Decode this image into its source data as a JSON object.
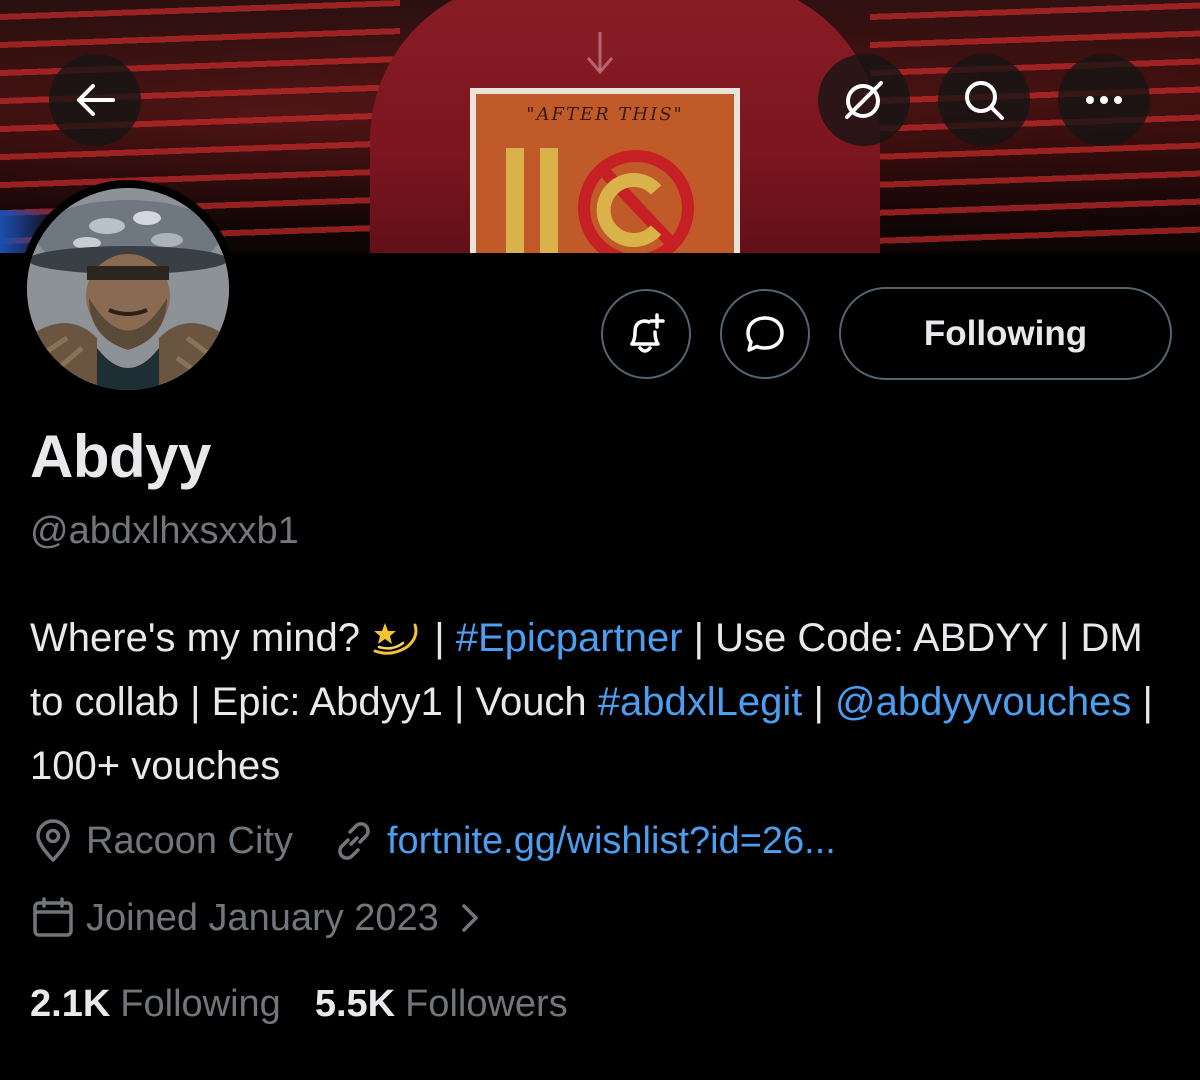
{
  "header": {
    "back_icon": "arrow-left-icon",
    "grok_icon": "grok-icon",
    "search_icon": "search-icon",
    "more_icon": "more-horizontal-icon",
    "banner_text": "\"AFTER THIS\""
  },
  "actions": {
    "notify_icon": "bell-plus-icon",
    "message_icon": "message-bubble-icon",
    "following_label": "Following"
  },
  "profile": {
    "display_name": "Abdyy",
    "handle": "@abdxlhxsxxb1",
    "bio": {
      "part1": "Where's my mind?",
      "emoji": "dizzy-star-emoji",
      "part2": "| ",
      "hashtag1": "#Epicpartner",
      "part3": " | Use Code: ABDYY | DM to collab | Epic: Abdyy1 | Vouch ",
      "hashtag2": "#abdxlLegit",
      "part4": " | ",
      "mention": "@abdyyvouches",
      "part5": " | 100+ vouches"
    },
    "location": "Racoon City",
    "website": "fortnite.gg/wishlist?id=26...",
    "joined": "Joined January 2023",
    "following_count": "2.1K",
    "following_label": "Following",
    "followers_count": "5.5K",
    "followers_label": "Followers"
  },
  "colors": {
    "background": "#000000",
    "text_primary": "#e7e9ea",
    "text_secondary": "#71767b",
    "link": "#4b9ef0",
    "border": "#536471"
  }
}
